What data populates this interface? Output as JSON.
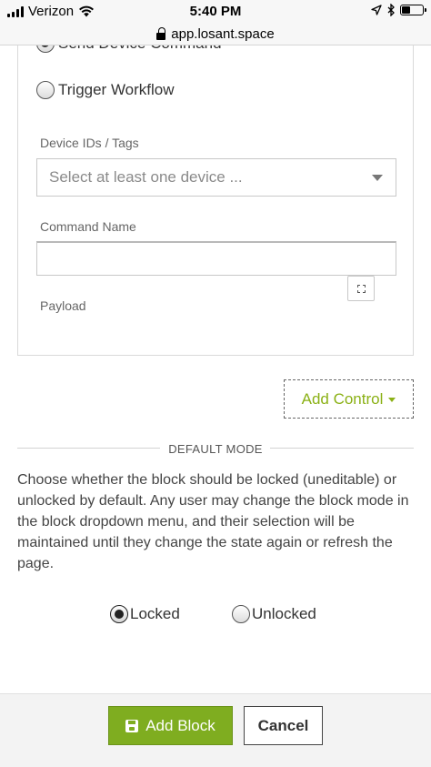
{
  "status_bar": {
    "carrier": "Verizon",
    "time": "5:40 PM",
    "icons": [
      "signal-icon",
      "wifi-icon",
      "location-icon",
      "bluetooth-icon",
      "battery-icon"
    ],
    "battery_level": 0.45
  },
  "url_bar": {
    "url": "app.losant.space"
  },
  "form": {
    "action_options": [
      {
        "label": "Send Device Command",
        "checked": true
      },
      {
        "label": "Trigger Workflow",
        "checked": false
      }
    ],
    "device_ids": {
      "label": "Device IDs / Tags",
      "placeholder": "Select at least one device ..."
    },
    "command_name": {
      "label": "Command Name",
      "value": ""
    },
    "payload": {
      "label": "Payload"
    }
  },
  "add_control": {
    "label": "Add Control"
  },
  "default_mode": {
    "heading": "DEFAULT MODE",
    "description": "Choose whether the block should be locked (uneditable) or unlocked by default. Any user may change the block mode in the block dropdown menu, and their selection will be maintained until they change the state again or refresh the page.",
    "options": [
      {
        "label": "Locked",
        "checked": true
      },
      {
        "label": "Unlocked",
        "checked": false
      }
    ]
  },
  "footer": {
    "add_block_label": "Add Block",
    "cancel_label": "Cancel"
  },
  "colors": {
    "accent_green": "#7fad20",
    "link_green": "#8bb116"
  }
}
